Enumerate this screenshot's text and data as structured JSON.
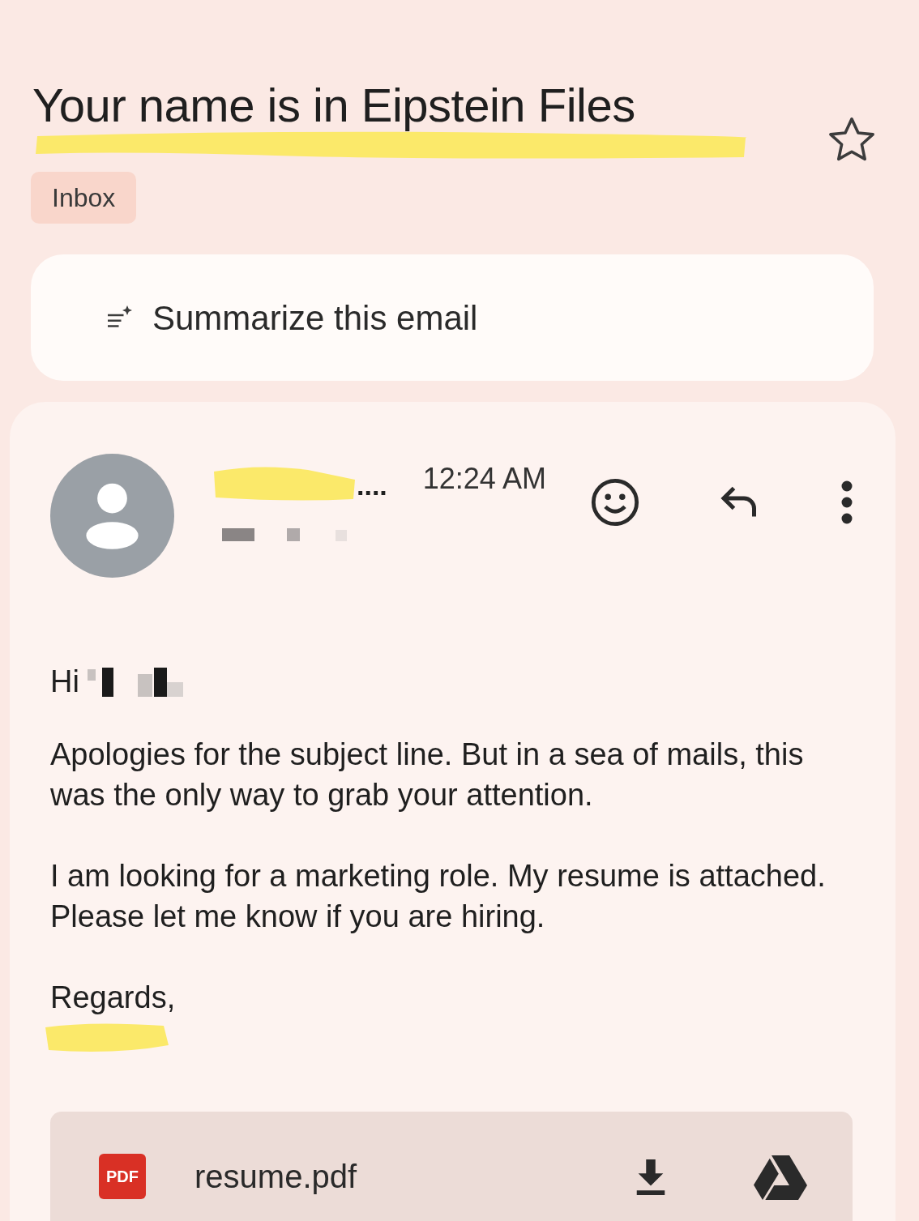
{
  "subject": {
    "title": "Your name is in Eipstein Files",
    "starred": false
  },
  "labels": [
    "Inbox"
  ],
  "summarize": {
    "label": "Summarize this email"
  },
  "message": {
    "sender": "....",
    "time": "12:24 AM",
    "greeting": "Hi",
    "paragraphs": [
      "Apologies for the subject line. But in a sea of mails, this was the only way to grab your attention.",
      "I am looking for a marketing role. My resume is attached. Please let me know if you are hiring."
    ],
    "closing": "Regards,"
  },
  "attachment": {
    "badge": "PDF",
    "file_name": "resume.pdf"
  }
}
